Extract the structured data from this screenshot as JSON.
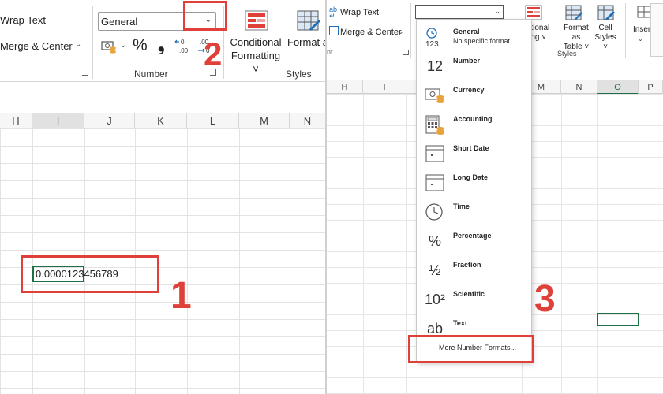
{
  "left": {
    "ribbon": {
      "wrap_text": "Wrap Text",
      "merge_center": "Merge & Center",
      "number_format_value": "General",
      "percent_symbol": "%",
      "comma_symbol": "❟",
      "increase_decimal": "←0\n.00",
      "decrease_decimal": ".00\n→0",
      "number_group_label": "Number",
      "conditional_formatting": "Conditional Formatting ˅",
      "format_as_table": "Format as Table ˅",
      "styles_group_label": "Styles"
    },
    "columns": [
      "H",
      "I",
      "J",
      "K",
      "L",
      "M",
      "N"
    ],
    "selected_column": "I",
    "cell_value": "0.0000123456789",
    "step_labels": {
      "one": "1",
      "two": "2"
    }
  },
  "right": {
    "ribbon": {
      "wrap_text": "Wrap Text",
      "merge_center": "Merge & Center",
      "alignment_tail": "nt",
      "conditional_formatting": "nditional\natting ˅",
      "format_as_table": "Format as\nTable ˅",
      "cell_styles": "Cell\nStyles ˅",
      "styles_group_label": "Styles",
      "insert": "Insert"
    },
    "columns": [
      "H",
      "I",
      "M",
      "N",
      "O",
      "P"
    ],
    "selected_column": "O",
    "dropdown": {
      "items": [
        {
          "icon": "general-icon",
          "glyph": "123",
          "label": "General",
          "sub": "No specific format"
        },
        {
          "icon": "number-icon",
          "glyph": "12",
          "label": "Number",
          "sub": ""
        },
        {
          "icon": "currency-icon",
          "glyph": "💲",
          "label": "Currency",
          "sub": ""
        },
        {
          "icon": "accounting-icon",
          "glyph": "▦",
          "label": "Accounting",
          "sub": ""
        },
        {
          "icon": "short-date-icon",
          "glyph": "▭",
          "label": "Short Date",
          "sub": ""
        },
        {
          "icon": "long-date-icon",
          "glyph": "▭",
          "label": "Long Date",
          "sub": ""
        },
        {
          "icon": "time-icon",
          "glyph": "◷",
          "label": "Time",
          "sub": ""
        },
        {
          "icon": "percentage-icon",
          "glyph": "%",
          "label": "Percentage",
          "sub": ""
        },
        {
          "icon": "fraction-icon",
          "glyph": "½",
          "label": "Fraction",
          "sub": ""
        },
        {
          "icon": "scientific-icon",
          "glyph": "10²",
          "label": "Scientific",
          "sub": ""
        },
        {
          "icon": "text-icon",
          "glyph": "ab",
          "label": "Text",
          "sub": ""
        }
      ],
      "more": "More Number Formats..."
    },
    "step_label": "3"
  },
  "colors": {
    "highlight": "#e0403a",
    "excel_green": "#1e7145",
    "accent_blue": "#1f6fb8"
  }
}
